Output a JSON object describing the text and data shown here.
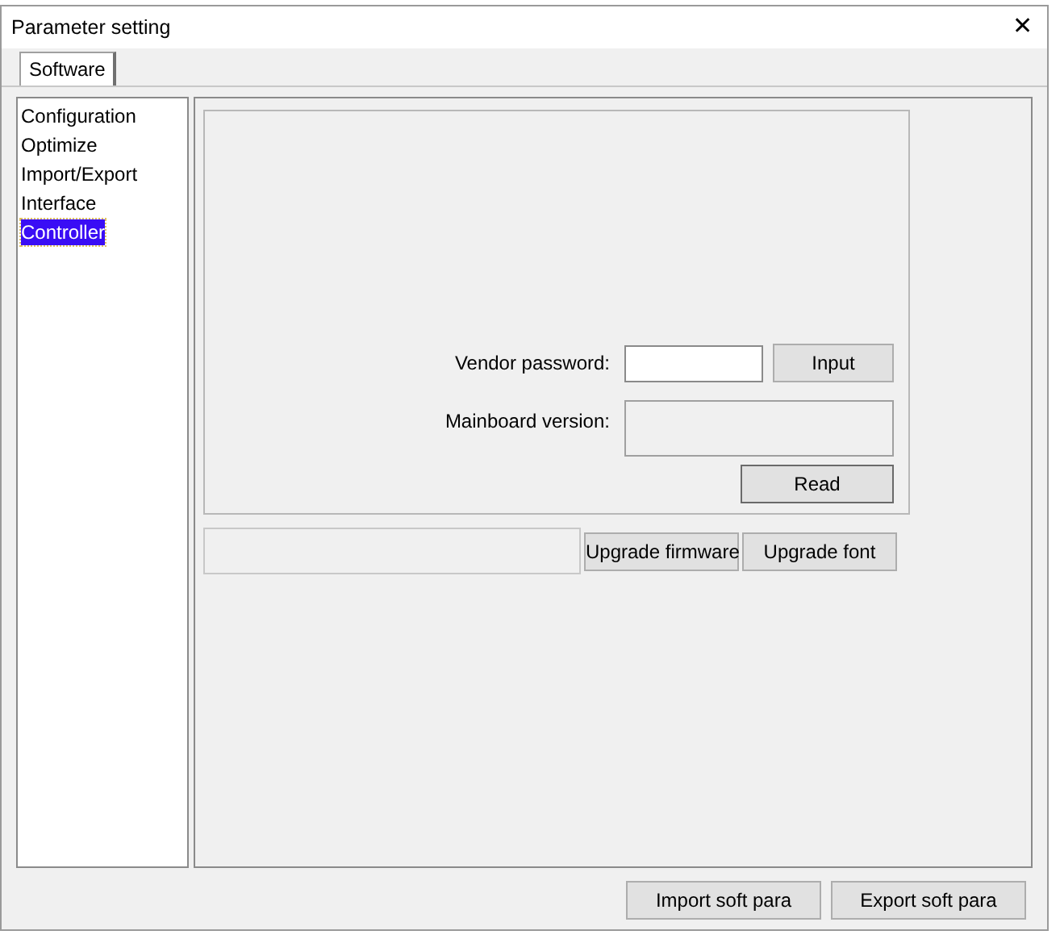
{
  "window": {
    "title": "Parameter setting",
    "close": "✕"
  },
  "tabs": [
    {
      "label": "Software",
      "selected": true
    }
  ],
  "sidebar": {
    "items": [
      {
        "label": "Configuration",
        "selected": false
      },
      {
        "label": "Optimize",
        "selected": false
      },
      {
        "label": "Import/Export",
        "selected": false
      },
      {
        "label": "Interface",
        "selected": false
      },
      {
        "label": "Controller",
        "selected": true
      }
    ]
  },
  "controller": {
    "vendor_password": {
      "label": "Vendor password:",
      "button": "Input"
    },
    "mainboard_version": {
      "label": "Mainboard version:",
      "button": "Read"
    },
    "upgrade_buttons": [
      "Upgrade firmware",
      "Upgrade font"
    ]
  },
  "buttons": [
    "Import soft para",
    "Export soft para"
  ]
}
